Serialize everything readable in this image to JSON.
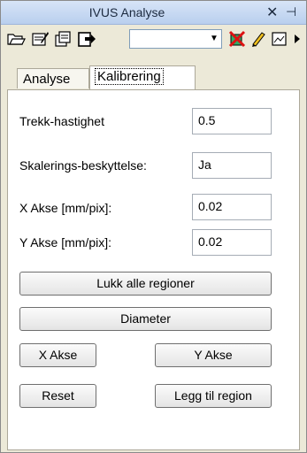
{
  "window": {
    "title": "IVUS Analyse",
    "close_glyph": "✕",
    "pin_glyph": "⊣"
  },
  "toolbar": {
    "icons": [
      "open-folder-icon",
      "edit-notes-icon",
      "multi-edit-icon",
      "export-icon",
      "red-x-tool-icon",
      "pencil-tool-icon",
      "image-tool-icon"
    ],
    "combo": {
      "value": ""
    }
  },
  "tabs": [
    {
      "label": "Analyse",
      "active": false
    },
    {
      "label": "Kalibrering",
      "active": true
    }
  ],
  "form": {
    "speed": {
      "label": "Trekk-hastighet",
      "value": "0.5"
    },
    "scale_protection": {
      "label": "Skalerings-beskyttelse:",
      "value": "Ja"
    },
    "x_axis": {
      "label": "X Akse [mm/pix]:",
      "value": "0.02"
    },
    "y_axis": {
      "label": "Y Akse [mm/pix]:",
      "value": "0.02"
    }
  },
  "buttons": {
    "close_regions": "Lukk alle regioner",
    "diameter": "Diameter",
    "x_axis": "X Akse",
    "y_axis": "Y Akse",
    "reset": "Reset",
    "add_region": "Legg til region"
  },
  "colors": {
    "titlebar": "#c7d8f2",
    "panel_bg": "#ece9d8",
    "content_bg": "#ffffff"
  }
}
